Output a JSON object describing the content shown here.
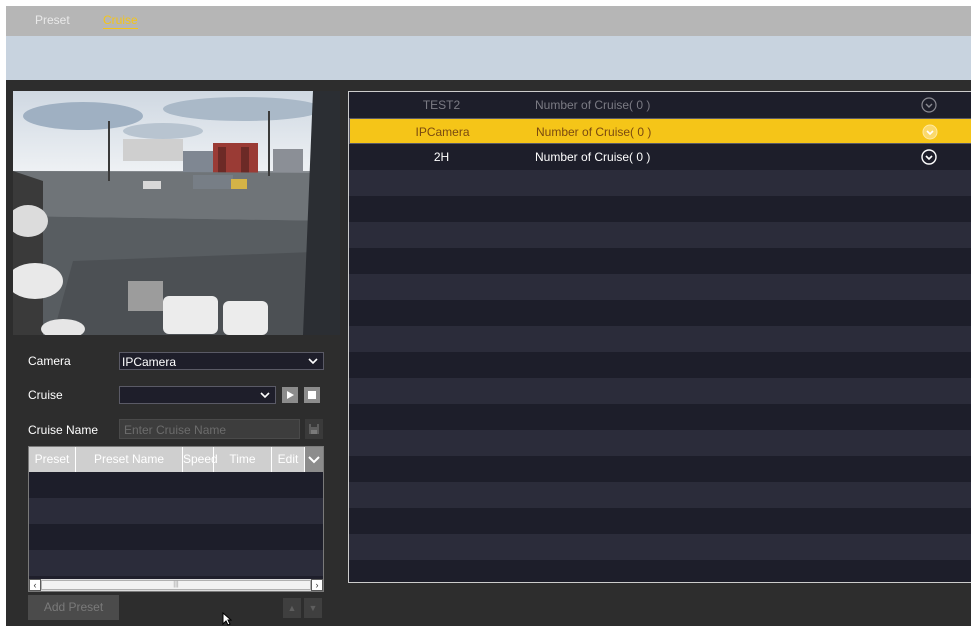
{
  "tabs": [
    {
      "label": "Preset",
      "active": false
    },
    {
      "label": "Cruise",
      "active": true
    }
  ],
  "form": {
    "camera_label": "Camera",
    "camera_value": "IPCamera",
    "cruise_label": "Cruise",
    "cruise_value": "",
    "cruise_name_label": "Cruise Name",
    "cruise_name_placeholder": "Enter Cruise Name"
  },
  "preset_table": {
    "columns": [
      "Preset",
      "Preset Name",
      "Speed",
      "Time",
      "Edit"
    ],
    "rows": []
  },
  "buttons": {
    "add_preset": "Add Preset"
  },
  "camera_list": [
    {
      "name": "TEST2",
      "count": "Number of Cruise( 0 )",
      "state": "disabled"
    },
    {
      "name": "IPCamera",
      "count": "Number of Cruise( 0 )",
      "state": "selected"
    },
    {
      "name": "2H",
      "count": "Number of Cruise( 0 )",
      "state": "normal"
    }
  ],
  "colors": {
    "accent": "#f5c518",
    "panel_bg": "#2d2d2d",
    "row_dark": "#1d1e2a",
    "row_light": "#2b2c3a"
  },
  "icons": [
    "play-icon",
    "stop-icon",
    "save-icon",
    "chevron-down-icon",
    "expand-circle-icon",
    "arrow-up-icon",
    "arrow-down-icon"
  ]
}
